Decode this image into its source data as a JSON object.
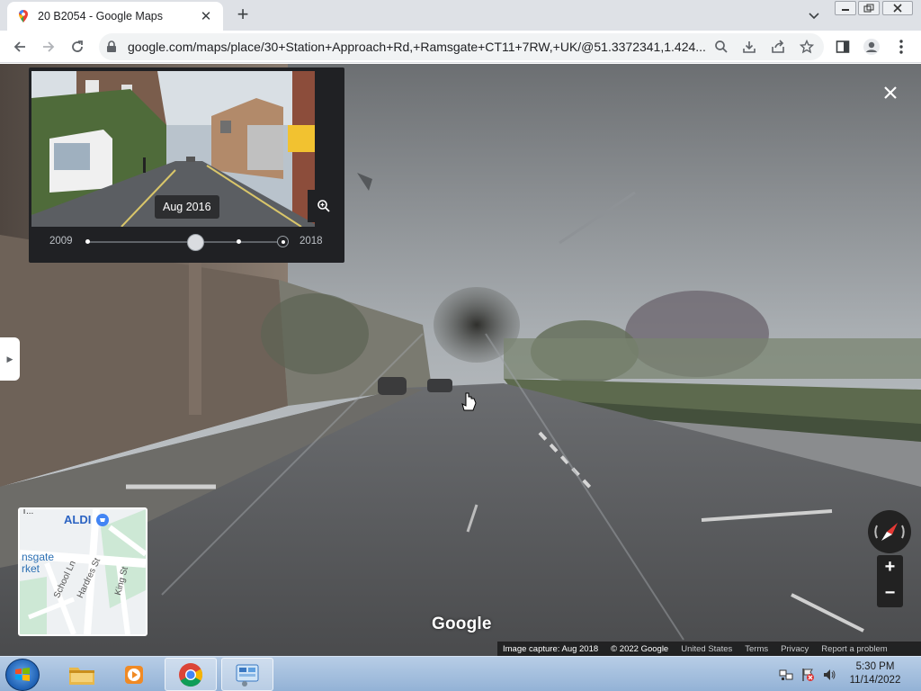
{
  "browser": {
    "tab_title": "20 B2054 - Google Maps",
    "tab_close_icon": "close-icon",
    "new_tab_icon": "plus-icon",
    "url": "google.com/maps/place/30+Station+Approach+Rd,+Ramsgate+CT11+7RW,+UK/@51.3372341,1.424...",
    "window_buttons": {
      "minimize": "minimize-icon",
      "maximize": "restore-icon",
      "close": "close-icon"
    }
  },
  "timeline": {
    "selected_date": "Aug 2016",
    "year_start": "2009",
    "year_end": "2018",
    "selected_fraction": 0.56
  },
  "minimap": {
    "labels": {
      "aldi": "ALDI",
      "market_1": "nsgate",
      "market_2": "rket",
      "street_school": "School Ln",
      "street_hardres": "Hardres St",
      "street_king": "King St",
      "top_fragment": "T..."
    }
  },
  "watermark": "Google",
  "attribution": {
    "capture": "Image capture: Aug 2018",
    "copyright": "© 2022 Google",
    "country": "United States",
    "terms": "Terms",
    "privacy": "Privacy",
    "report": "Report a problem"
  },
  "taskbar": {
    "time": "5:30 PM",
    "date": "11/14/2022"
  }
}
